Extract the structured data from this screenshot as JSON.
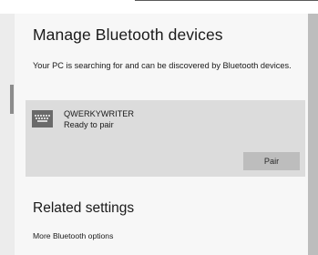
{
  "page": {
    "title": "Manage Bluetooth devices",
    "description": "Your PC is searching for and can be discovered by Bluetooth devices."
  },
  "device": {
    "icon": "keyboard-icon",
    "name": "QWERKYWRITER",
    "status": "Ready to pair",
    "pair_label": "Pair"
  },
  "related": {
    "heading": "Related settings",
    "link_label": "More Bluetooth options"
  },
  "colors": {
    "background": "#9a9a9a",
    "panel": "#f7f7f7",
    "card": "#dcdcdc",
    "button": "#bdbdbd",
    "icon": "#6a6a6a"
  }
}
